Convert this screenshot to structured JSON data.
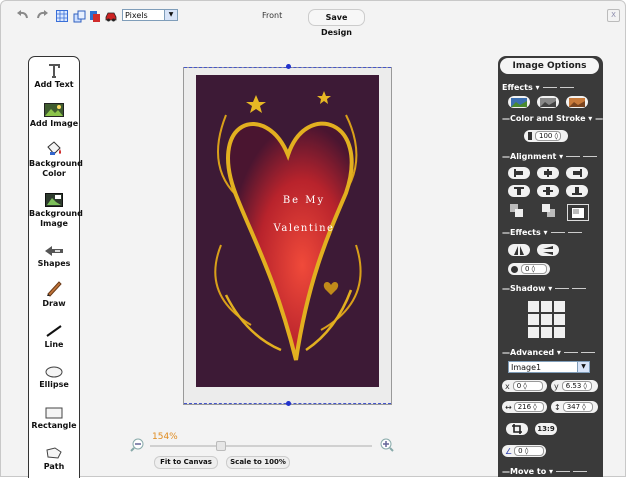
{
  "toolbar": {
    "units_value": "Pixels",
    "side_label": "Front",
    "save_label": "Save Design",
    "close_label": "X"
  },
  "tools": [
    {
      "label": "Add Text",
      "icon": "text-icon"
    },
    {
      "label": "Add Image",
      "icon": "image-icon"
    },
    {
      "label": "Background Color",
      "icon": "paint-bucket-icon"
    },
    {
      "label": "Background Image",
      "icon": "background-image-icon"
    },
    {
      "label": "Shapes",
      "icon": "shapes-icon"
    },
    {
      "label": "Draw",
      "icon": "pencil-icon"
    },
    {
      "label": "Line",
      "icon": "line-icon"
    },
    {
      "label": "Ellipse",
      "icon": "ellipse-icon"
    },
    {
      "label": "Rectangle",
      "icon": "rectangle-icon"
    },
    {
      "label": "Path",
      "icon": "path-icon"
    }
  ],
  "canvas": {
    "text_line1": "Be My",
    "text_line2": "Valentine"
  },
  "zoom": {
    "percent": "154%",
    "fit_label": "Fit to Canvas",
    "scale_label": "Scale to 100%"
  },
  "panel": {
    "title": "Image Options",
    "effects_label": "Effects",
    "color_stroke_label": "Color and Stroke",
    "stroke_value": "100",
    "alignment_label": "Alignment",
    "effects2_label": "Effects",
    "blur_value": "0",
    "shadow_label": "Shadow",
    "advanced_label": "Advanced",
    "object_select": "Image1",
    "x_label": "x",
    "x_value": "0",
    "y_label": "y",
    "y_value": "6.53",
    "width_value": "216",
    "height_value": "347",
    "ratio_label": "13:9",
    "angle_value": "0",
    "move_to_label": "Move to"
  },
  "colors": {
    "panel_bg": "#3a3a3a",
    "art_bg": "#3d1a36",
    "heart": "#c0242c",
    "gold": "#e2b020",
    "zoom_percent": "#e08b1e",
    "selection": "#2233cc"
  }
}
